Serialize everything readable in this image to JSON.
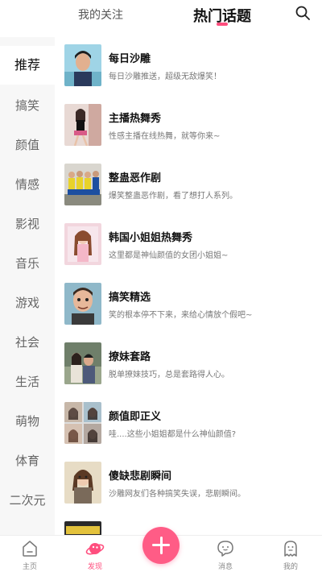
{
  "header": {
    "tab_follow": "我的关注",
    "tab_hot": "热门话题",
    "search_icon": "search-icon"
  },
  "sidebar": {
    "items": [
      {
        "label": "推荐",
        "active": true
      },
      {
        "label": "搞笑"
      },
      {
        "label": "颜值"
      },
      {
        "label": "情感"
      },
      {
        "label": "影视"
      },
      {
        "label": "音乐"
      },
      {
        "label": "游戏"
      },
      {
        "label": "社会"
      },
      {
        "label": "生活"
      },
      {
        "label": "萌物"
      },
      {
        "label": "体育"
      },
      {
        "label": "二次元"
      }
    ]
  },
  "topics": [
    {
      "title": "每日沙雕",
      "desc": "每日沙雕推送，超级无敌爆笑！"
    },
    {
      "title": "主播热舞秀",
      "desc": "性感主播在线热舞，就等你来~"
    },
    {
      "title": "整蛊恶作剧",
      "desc": "爆笑整蛊恶作剧，看了想打人系列。"
    },
    {
      "title": "韩国小姐姐热舞秀",
      "desc": "这里都是神仙颜值的女团小姐姐~"
    },
    {
      "title": "搞笑精选",
      "desc": "笑的根本停不下来，来给心情放个假吧~"
    },
    {
      "title": "撩妹套路",
      "desc": "脱单撩妹技巧，总是套路得人心。"
    },
    {
      "title": "颜值即正义",
      "desc": "哇....这些小姐姐都是什么神仙颜值?"
    },
    {
      "title": "傻缺悲剧瞬间",
      "desc": "沙雕网友们各种搞笑失误，悲剧瞬间。"
    }
  ],
  "bottom_nav": {
    "home": "主页",
    "discover": "发现",
    "messages": "消息",
    "mine": "我的"
  },
  "colors": {
    "accent": "#ff4e7e",
    "sidebar_bg": "#f7f7f7"
  }
}
